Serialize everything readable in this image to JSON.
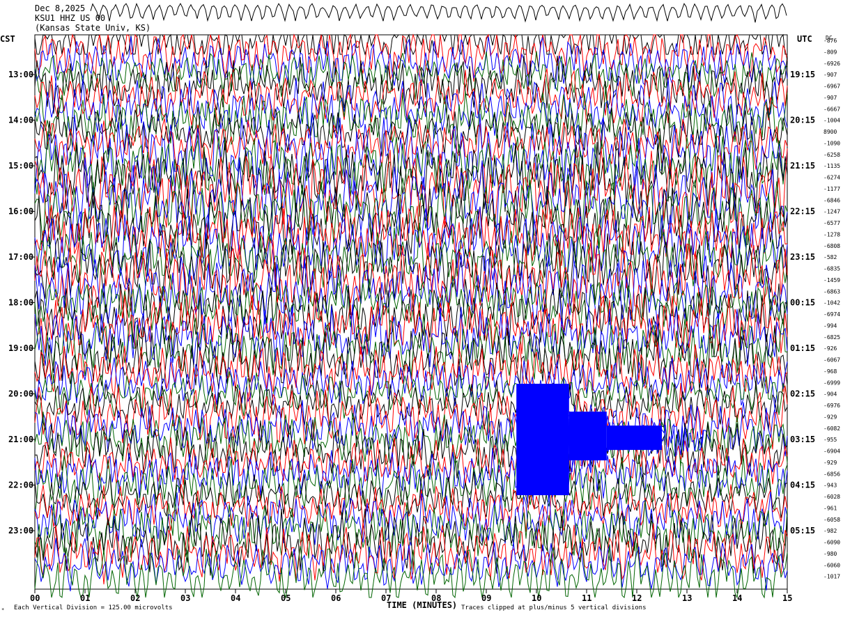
{
  "header": {
    "line1": "Dec 8,2025",
    "line2": "KSU1 HHZ US 00",
    "line3": "(Kansas State Univ, KS)"
  },
  "left_tz": "CST",
  "right_tz": "UTC",
  "dc_label": "DC",
  "footer": {
    "scale_note": "Each Vertical Division = 125.00 microvolts",
    "x_title": "TIME (MINUTES)",
    "clip_note": "Traces clipped at plus/minus 5 vertical divisions"
  },
  "colors": {
    "trace_cycle": [
      "#000000",
      "#ff0000",
      "#0000ff",
      "#006400"
    ],
    "grid": "#000000",
    "event": "#0000ff"
  },
  "chart_data": {
    "type": "line",
    "xlabel": "TIME (MINUTES)",
    "x_ticks": [
      "00",
      "01",
      "02",
      "03",
      "04",
      "05",
      "06",
      "07",
      "08",
      "09",
      "10",
      "11",
      "12",
      "13",
      "14",
      "15"
    ],
    "xlim": [
      0,
      15
    ],
    "left_hour_labels": [
      "13:00",
      "14:00",
      "15:00",
      "16:00",
      "17:00",
      "18:00",
      "19:00",
      "20:00",
      "21:00",
      "22:00",
      "23:00"
    ],
    "right_hour_labels": [
      "19:15",
      "20:15",
      "21:15",
      "22:15",
      "23:15",
      "00:15",
      "01:15",
      "02:15",
      "03:15",
      "04:15",
      "05:15"
    ],
    "dc_offsets": [
      "-876",
      "-809",
      "-6926",
      "-907",
      "-6967",
      "-907",
      "-6667",
      "-1004",
      "8900",
      "-1090",
      "-6258",
      "-1135",
      "-6274",
      "-1177",
      "-6846",
      "-1247",
      "-6577",
      "-1278",
      "-6808",
      "-582",
      "-6835",
      "-1459",
      "-6863",
      "-1042",
      "-6974",
      "-994",
      "-6825",
      "-926",
      "-6067",
      "-968",
      "-6999",
      "-904",
      "-6976",
      "-929",
      "-6082",
      "-955",
      "-6904",
      "-929",
      "-6856",
      "-943",
      "-6028",
      "-961",
      "-6058",
      "-982",
      "-6090",
      "-980",
      "-6060",
      "-1017"
    ],
    "traces_per_hour": 4,
    "trace_count": 48,
    "event_window_minutes": [
      9.6,
      12.5
    ],
    "event_peak_trace_index": 35
  }
}
